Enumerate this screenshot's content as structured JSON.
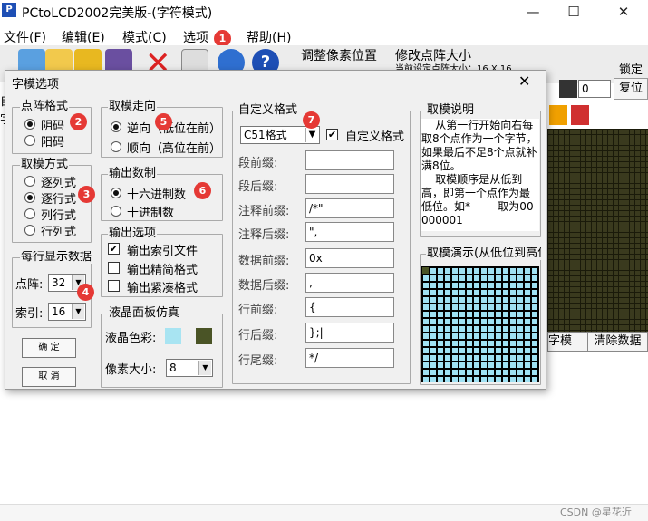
{
  "app": {
    "title": "PCtoLCD2002完美版-(字符模式)",
    "logo": "P"
  },
  "window_controls": {
    "minimize": "—",
    "maximize": "☐",
    "close": "✕"
  },
  "menu": [
    "文件(F)",
    "编辑(E)",
    "模式(C)",
    "选项",
    "帮助(H)"
  ],
  "badges": [
    "1",
    "2",
    "3",
    "4",
    "5",
    "6",
    "7"
  ],
  "bg": {
    "adjust_pixel": "调整像素位置",
    "modify_size": "修改点阵大小",
    "modify_partial": "当前设定点阵大小：16 X 16",
    "lock": "锁定",
    "spin_val": "0",
    "reset": "复位",
    "left_cut": "自",
    "left_cut2": "字",
    "btn_gen_partial": "字模",
    "btn_clear": "清除数据"
  },
  "dialog": {
    "title": "字模选项",
    "close": "✕",
    "dot_format": {
      "legend": "点阵格式",
      "opts": [
        "阴码",
        "阳码"
      ],
      "selected": 0
    },
    "mode": {
      "legend": "取模方式",
      "opts": [
        "逐列式",
        "逐行式",
        "列行式",
        "行列式"
      ],
      "selected": 1
    },
    "perline": {
      "legend": "每行显示数据",
      "dot_label": "点阵:",
      "dot_value": "32",
      "index_label": "索引:",
      "index_value": "16"
    },
    "buttons": {
      "ok": "确    定",
      "cancel": "取    消"
    },
    "direction": {
      "legend": "取模走向",
      "opts": [
        "逆向（低位在前）",
        "顺向（高位在前）"
      ],
      "selected": 0
    },
    "radix": {
      "legend": "输出数制",
      "opts": [
        "十六进制数",
        "十进制数"
      ],
      "selected": 0
    },
    "output": {
      "legend": "输出选项",
      "opts": [
        "输出索引文件",
        "输出精简格式",
        "输出紧凑格式"
      ],
      "checked": [
        true,
        false,
        false
      ]
    },
    "lcd": {
      "legend": "液晶面板仿真",
      "color_label": "液晶色彩:",
      "size_label": "像素大小:",
      "size_value": "8",
      "color1": "#a8e4f2",
      "color2": "#4a5426"
    },
    "custom": {
      "legend": "自定义格式",
      "format_value": "C51格式",
      "check_label": "自定义格式",
      "checked": true,
      "fields": [
        {
          "label": "段前缀:",
          "value": ""
        },
        {
          "label": "段后缀:",
          "value": ""
        },
        {
          "label": "注释前缀:",
          "value": "/*\""
        },
        {
          "label": "注释后缀:",
          "value": "\","
        },
        {
          "label": "数据前缀:",
          "value": "0x"
        },
        {
          "label": "数据后缀:",
          "value": ","
        },
        {
          "label": "行前缀:",
          "value": "{"
        },
        {
          "label": "行后缀:",
          "value": "};|"
        },
        {
          "label": "行尾缀:",
          "value": "*/"
        }
      ]
    },
    "explain": {
      "legend": "取模说明",
      "text": "    从第一行开始向右每取8个点作为一个字节，如果最后不足8个点就补满8位。\n    取模顺序是从低到高，即第一个点作为最低位。如*-------取为00000001"
    },
    "demo": {
      "legend": "取模演示(从低位到高位)"
    }
  },
  "watermark": "CSDN @星花近"
}
